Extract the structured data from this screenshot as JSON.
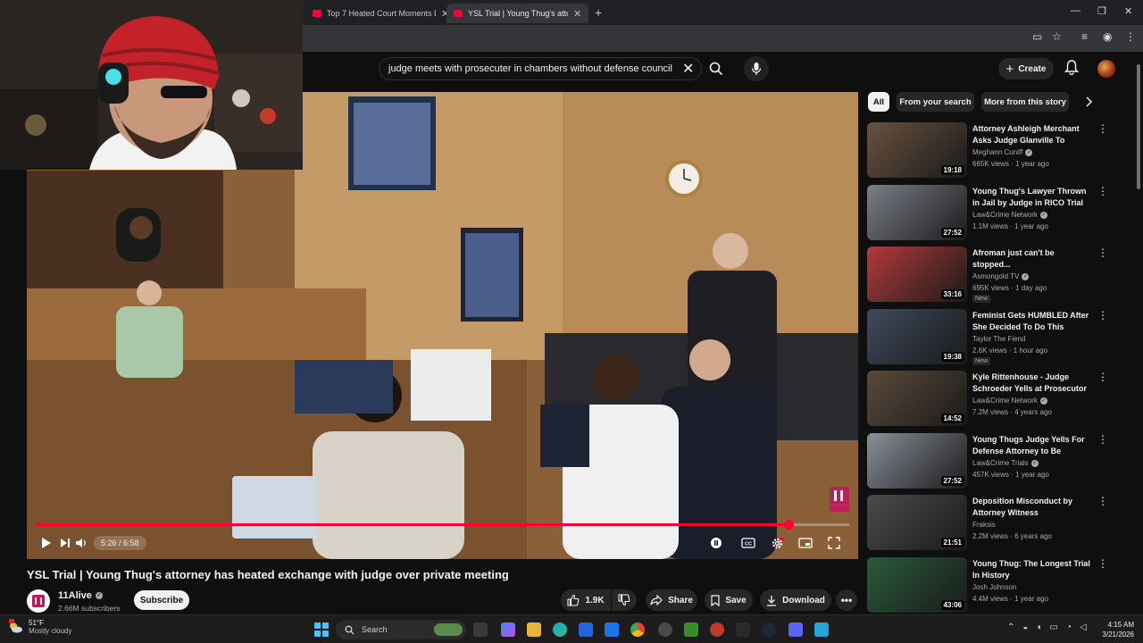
{
  "browser": {
    "tabs": [
      {
        "label": "Top 7 Heated Court Moments E"
      },
      {
        "label": "YSL Trial | Young Thug's attorne"
      }
    ]
  },
  "search": {
    "query": "judge meets with prosecuter in chambers without defense council"
  },
  "header": {
    "create_label": "Create"
  },
  "player": {
    "current_time": "5:26",
    "separator": " / ",
    "duration": "6:58",
    "progress_fraction": 0.925,
    "accent_color": "#ff0033"
  },
  "video": {
    "title": "YSL Trial | Young Thug's attorney has heated exchange with judge over private meeting",
    "channel": "11Alive",
    "subscribers": "2.66M subscribers",
    "subscribe_label": "Subscribe",
    "likes": "1.9K",
    "share_label": "Share",
    "save_label": "Save",
    "download_label": "Download"
  },
  "sidebar": {
    "chips": [
      "All",
      "From your search",
      "More from this story"
    ],
    "recommendations": [
      {
        "title": "Attorney Ashleigh Merchant Asks Judge Glanville To Recus...",
        "channel": "Meghann Cuniff",
        "verified": true,
        "meta": "665K views · 1 year ago",
        "duration": "19:18",
        "badge": "",
        "thumb_color": "#6a5240"
      },
      {
        "title": "Young Thug's Lawyer Thrown in Jail by Judge in RICO Trial",
        "channel": "Law&Crime Network",
        "verified": true,
        "meta": "1.1M views · 1 year ago",
        "duration": "27:52",
        "badge": "",
        "thumb_color": "#7b7f88"
      },
      {
        "title": "Afroman just can't be stopped...",
        "channel": "Asmongold TV",
        "verified": true,
        "meta": "695K views · 1 day ago",
        "duration": "33:16",
        "badge": "New",
        "thumb_color": "#b33a3a"
      },
      {
        "title": "Feminist Gets HUMBLED After She Decided To Do This",
        "channel": "Taylor The Fiend",
        "verified": false,
        "meta": "2.6K views · 1 hour ago",
        "duration": "19:38",
        "badge": "New",
        "thumb_color": "#3e4a5c"
      },
      {
        "title": "Kyle Rittenhouse - Judge Schroeder Yells at Prosecutor ...",
        "channel": "Law&Crime Network",
        "verified": true,
        "meta": "7.2M views · 4 years ago",
        "duration": "14:52",
        "badge": "",
        "thumb_color": "#5a4a3a"
      },
      {
        "title": "Young Thugs Judge Yells For Defense Attorney to Be Placed...",
        "channel": "Law&Crime Trials",
        "verified": true,
        "meta": "457K views · 1 year ago",
        "duration": "27:52",
        "badge": "",
        "thumb_color": "#8a8f99"
      },
      {
        "title": "Deposition Misconduct by Attorney Witness",
        "channel": "Fraksis",
        "verified": false,
        "meta": "2.2M views · 6 years ago",
        "duration": "21:51",
        "badge": "",
        "thumb_color": "#4a4a4a"
      },
      {
        "title": "Young Thug: The Longest Trial In History",
        "channel": "Josh Johnson",
        "verified": false,
        "meta": "4.4M views · 1 year ago",
        "duration": "43:06",
        "badge": "",
        "thumb_color": "#2a5a3a"
      }
    ]
  },
  "taskbar": {
    "temperature": "51°F",
    "weather": "Mostly cloudy",
    "search_label": "Search",
    "time": "4:15 AM",
    "date": "3/21/2026"
  }
}
